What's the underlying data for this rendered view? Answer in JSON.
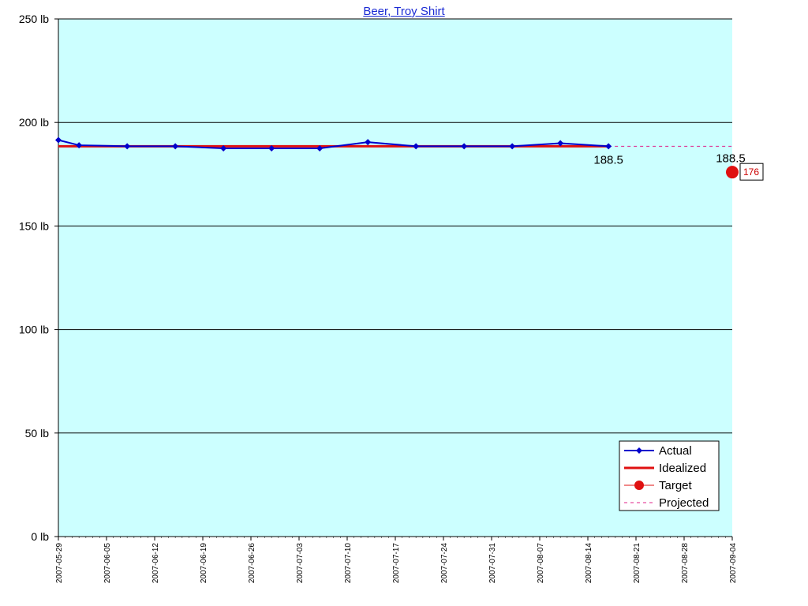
{
  "chart_data": {
    "type": "line",
    "title": "Beer, Troy Shirt",
    "xlabel": "",
    "ylabel": "",
    "ylim": [
      0,
      250
    ],
    "yticks": [
      0,
      50,
      100,
      150,
      200,
      250
    ],
    "ytick_labels": [
      "0 lb",
      "50 lb",
      "100 lb",
      "150 lb",
      "200 lb",
      "250 lb"
    ],
    "xlim": [
      "2007-05-29",
      "2007-09-04"
    ],
    "x_tick_labels": [
      "2007-05-29",
      "2007-06-05",
      "2007-06-12",
      "2007-06-19",
      "2007-06-26",
      "2007-07-03",
      "2007-07-10",
      "2007-07-17",
      "2007-07-24",
      "2007-07-31",
      "2007-08-07",
      "2007-08-14",
      "2007-08-21",
      "2007-08-28",
      "2007-09-04"
    ],
    "grid": "horizontal",
    "background": "#ccffff",
    "legend_position": "bottom-right",
    "series": [
      {
        "name": "Actual",
        "style": "line-diamond",
        "color": "#0000cc",
        "x": [
          "2007-05-29",
          "2007-06-01",
          "2007-06-08",
          "2007-06-15",
          "2007-06-22",
          "2007-06-29",
          "2007-07-06",
          "2007-07-13",
          "2007-07-20",
          "2007-07-27",
          "2007-08-03",
          "2007-08-10",
          "2007-08-17"
        ],
        "y": [
          191.5,
          189,
          188.5,
          188.5,
          187.5,
          187.5,
          187.5,
          190.5,
          188.5,
          188.5,
          188.5,
          190,
          188.5
        ]
      },
      {
        "name": "Idealized",
        "style": "thick-line",
        "color": "#e01010",
        "x": [
          "2007-05-29",
          "2007-08-17"
        ],
        "y": [
          188.5,
          188.5
        ]
      },
      {
        "name": "Target",
        "style": "marker",
        "color": "#e01010",
        "x": [
          "2007-09-04"
        ],
        "y": [
          176
        ]
      },
      {
        "name": "Projected",
        "style": "dashed",
        "color": "#e0208a",
        "x": [
          "2007-08-17",
          "2007-09-04"
        ],
        "y": [
          188.5,
          188.5
        ]
      }
    ],
    "annotations": [
      {
        "text": "188.5",
        "x": "2007-08-17",
        "y": 188.5
      },
      {
        "text": "188.5",
        "x": "2007-09-04",
        "y": 188.5
      },
      {
        "text": "176",
        "x": "2007-09-04",
        "y": 176,
        "boxed": true,
        "color": "#cc0000"
      }
    ]
  }
}
